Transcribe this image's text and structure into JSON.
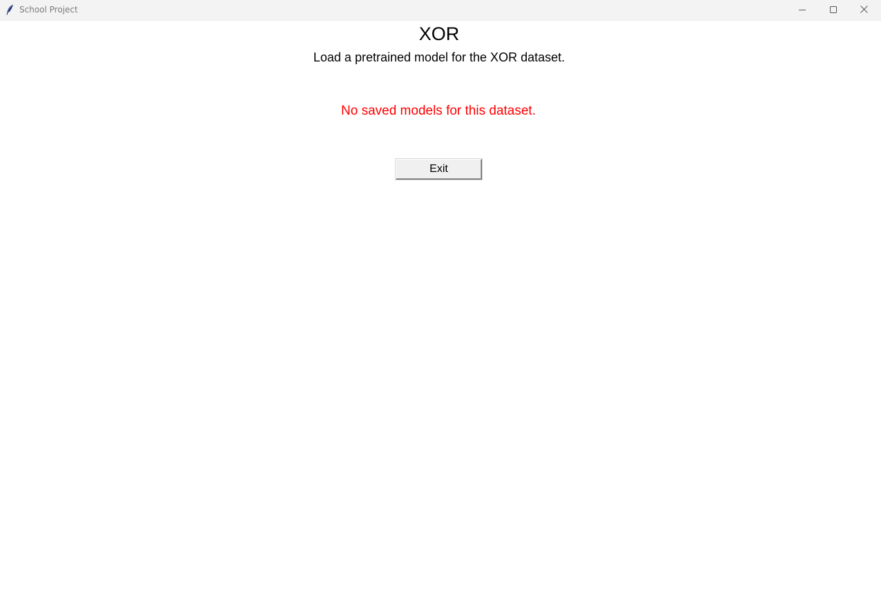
{
  "window": {
    "title": "School Project"
  },
  "titlebar_icons": {
    "app": "feather-icon",
    "minimize": "minimize-icon",
    "maximize": "maximize-icon",
    "close": "close-icon"
  },
  "main": {
    "heading": "XOR",
    "subtitle": "Load a pretrained model for the XOR dataset.",
    "message": "No saved models for this dataset.",
    "exit_label": "Exit"
  },
  "colors": {
    "message": "#ff0000",
    "titlebar": "#f3f3f3",
    "button_face": "#f0f0f0"
  }
}
